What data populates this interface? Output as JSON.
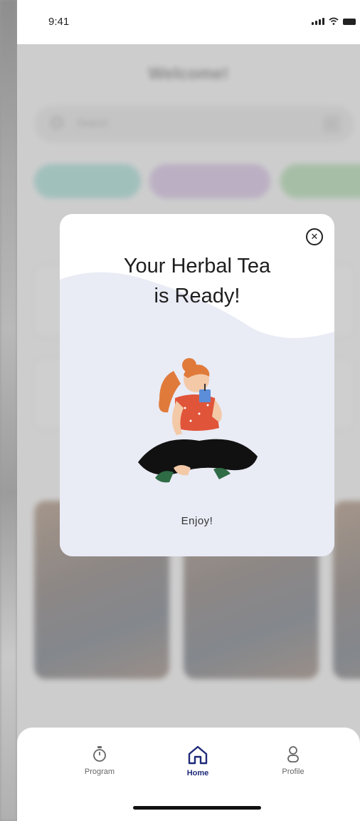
{
  "status_bar": {
    "time": "9:41"
  },
  "background": {
    "title": "Welcome!",
    "search_placeholder": "Search",
    "pills": [
      {
        "color": "#7fd6cc"
      },
      {
        "color": "#c9a7e0"
      },
      {
        "color": "#8fd18e"
      }
    ]
  },
  "modal": {
    "title": "Your Herbal Tea\nis Ready!",
    "caption": "Enjoy!",
    "close_icon": "close-circle-icon",
    "wave_color": "#e9ebf5"
  },
  "bottom_nav": {
    "items": [
      {
        "label": "Program",
        "icon": "timer-icon",
        "active": false
      },
      {
        "label": "Home",
        "icon": "home-icon",
        "active": true
      },
      {
        "label": "Profile",
        "icon": "person-icon",
        "active": false
      }
    ]
  },
  "colors": {
    "accent": "#1e2a78"
  }
}
